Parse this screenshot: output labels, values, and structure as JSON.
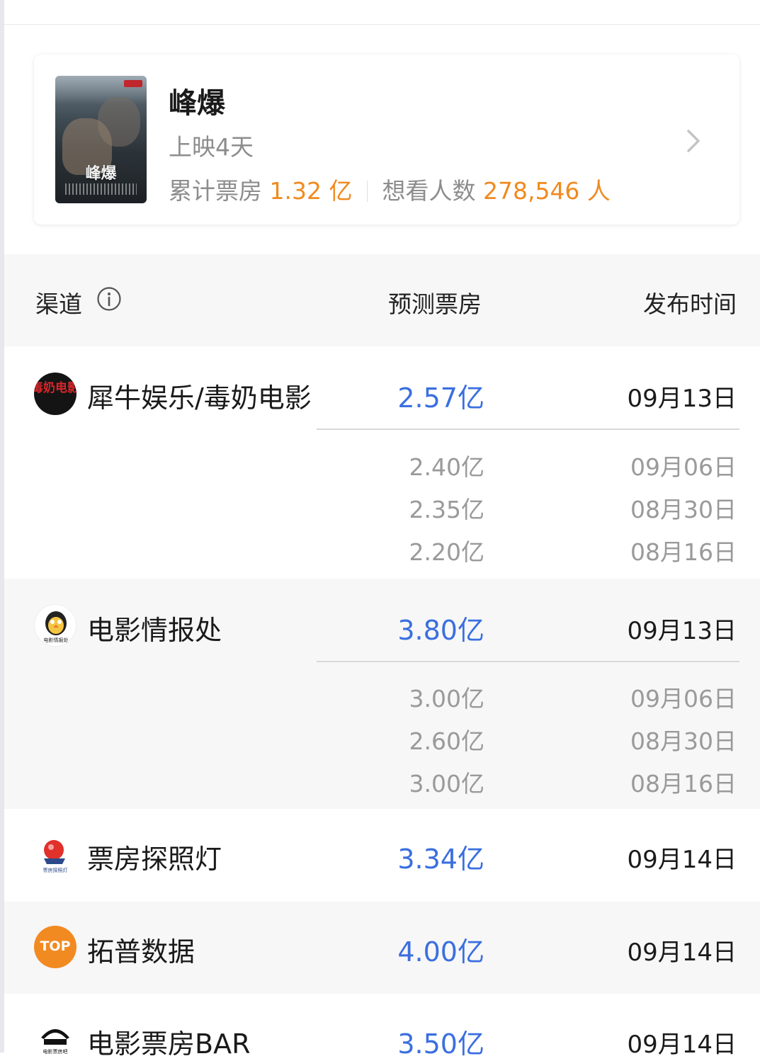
{
  "movie": {
    "poster_title": "峰爆",
    "title": "峰爆",
    "release_info": "上映4天",
    "box_office_label": "累计票房",
    "box_office_value": "1.32 亿",
    "want_label": "想看人数",
    "want_value": "278,546 人"
  },
  "table_header": {
    "channel": "渠道",
    "prediction": "预测票房",
    "publish_time": "发布时间"
  },
  "channels": [
    {
      "name": "犀牛娱乐/毒奶电影",
      "logo_text": "毒奶电影",
      "prediction": "2.57亿",
      "date": "09月13日",
      "history": [
        {
          "value": "2.40亿",
          "date": "09月06日"
        },
        {
          "value": "2.35亿",
          "date": "08月30日"
        },
        {
          "value": "2.20亿",
          "date": "08月16日"
        }
      ]
    },
    {
      "name": "电影情报处",
      "logo_text": "电影情报处",
      "prediction": "3.80亿",
      "date": "09月13日",
      "history": [
        {
          "value": "3.00亿",
          "date": "09月06日"
        },
        {
          "value": "2.60亿",
          "date": "08月30日"
        },
        {
          "value": "3.00亿",
          "date": "08月16日"
        }
      ]
    },
    {
      "name": "票房探照灯",
      "logo_text": "票房探照灯",
      "prediction": "3.34亿",
      "date": "09月14日",
      "history": []
    },
    {
      "name": "拓普数据",
      "logo_text": "TOP",
      "prediction": "4.00亿",
      "date": "09月14日",
      "history": []
    },
    {
      "name": "电影票房BAR",
      "logo_text": "电影票房吧",
      "prediction": "3.50亿",
      "date": "09月14日",
      "history": []
    }
  ],
  "colors": {
    "accent_blue": "#3b6fe0",
    "accent_orange": "#f08a1f",
    "muted_gray": "#9a9a9a"
  },
  "icons": [
    "chevron-right-icon",
    "info-icon"
  ]
}
